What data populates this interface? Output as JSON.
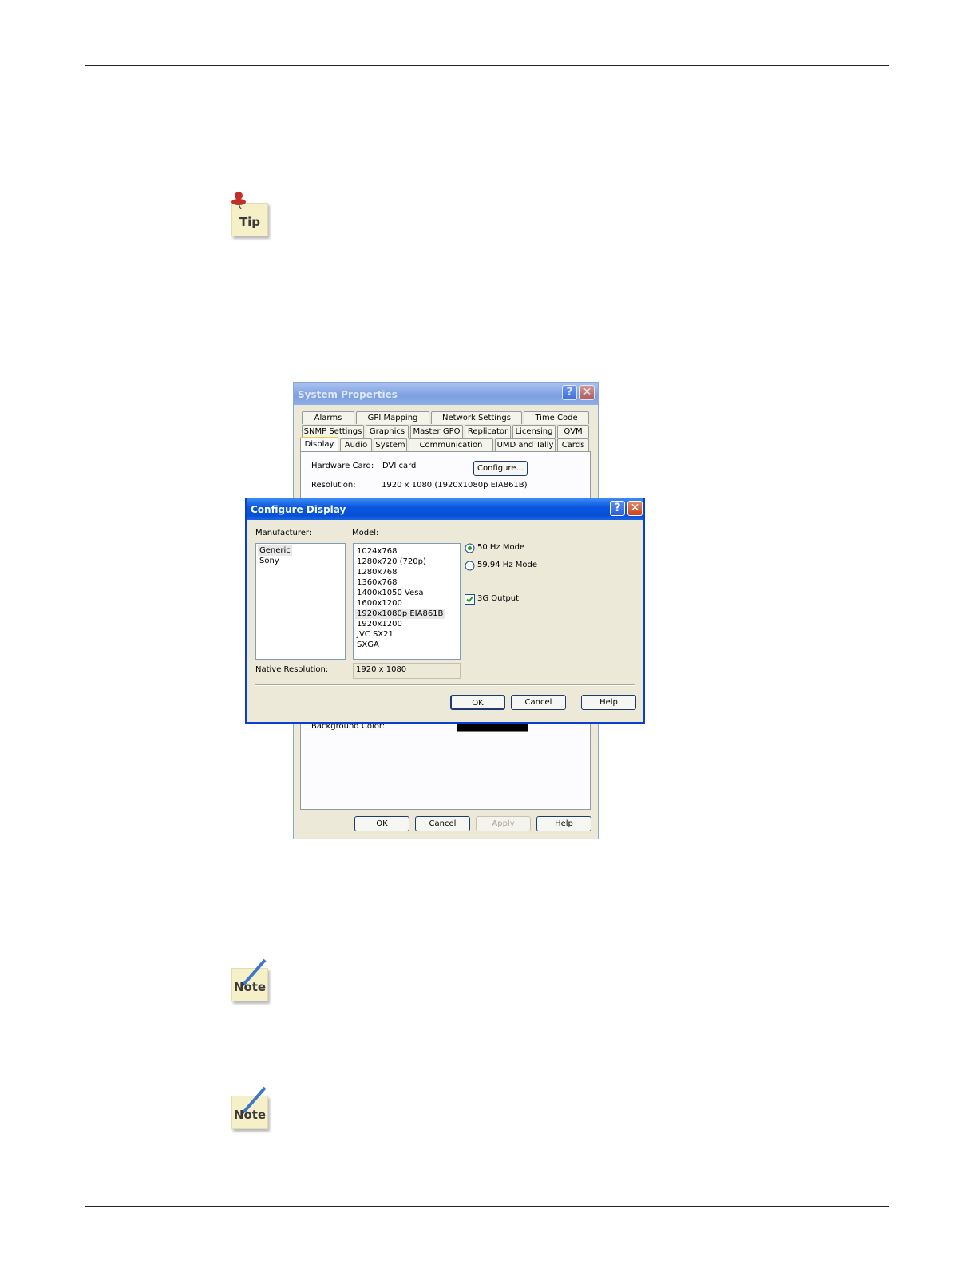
{
  "tip_label": "Tip",
  "note_labels": [
    "Note",
    "Note"
  ],
  "system_properties": {
    "title": "System Properties",
    "tabs_row1": [
      "Alarms",
      "GPI Mapping",
      "Network Settings",
      "Time Code"
    ],
    "tabs_row2": [
      "SNMP Settings",
      "Graphics",
      "Master GPO",
      "Replicator",
      "Licensing",
      "QVM"
    ],
    "tabs_row3": [
      "Display",
      "Audio",
      "System",
      "Communication Ports",
      "UMD and Tally",
      "Cards"
    ],
    "hardware_card_label": "Hardware Card:",
    "hardware_card_value": "DVI card",
    "configure_button": "Configure...",
    "resolution_label": "Resolution:",
    "resolution_value": "1920 x 1080 (1920x1080p EIA861B)",
    "background_color_label": "Background Color:",
    "background_color": "#000000",
    "buttons": {
      "ok": "OK",
      "cancel": "Cancel",
      "apply": "Apply",
      "help": "Help"
    }
  },
  "configure_display": {
    "title": "Configure Display",
    "manufacturer_label": "Manufacturer:",
    "manufacturers": [
      "Generic",
      "Sony"
    ],
    "selected_manufacturer": "Generic",
    "model_label": "Model:",
    "models": [
      "1024x768",
      "1280x720 (720p)",
      "1280x768",
      "1360x768",
      "1400x1050 Vesa",
      "1600x1200",
      "1920x1080p EIA861B",
      "1920x1200",
      "JVC SX21",
      "SXGA"
    ],
    "selected_model": "1920x1080p EIA861B",
    "mode_50": "50 Hz Mode",
    "mode_5994": "59.94 Hz Mode",
    "selected_mode": "50 Hz Mode",
    "output_3g": "3G Output",
    "output_3g_checked": true,
    "native_resolution_label": "Native Resolution:",
    "native_resolution_value": "1920 x 1080",
    "buttons": {
      "ok": "OK",
      "cancel": "Cancel",
      "help": "Help"
    }
  }
}
